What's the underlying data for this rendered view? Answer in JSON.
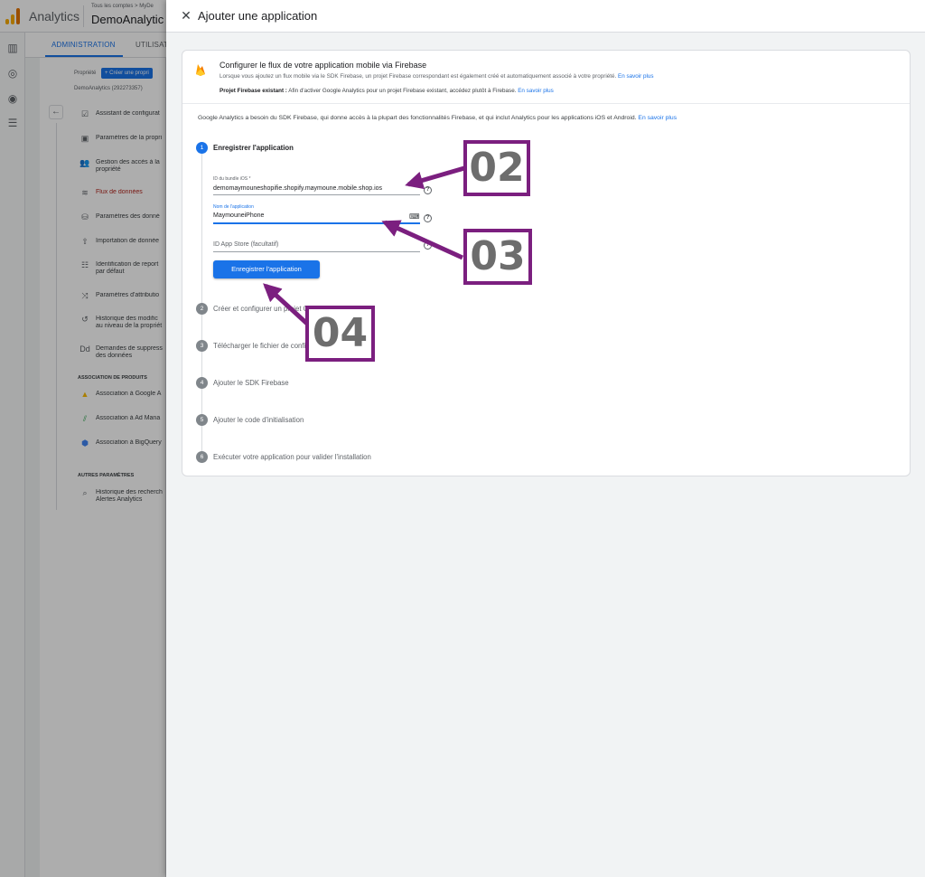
{
  "background": {
    "app_name": "Analytics",
    "breadcrumb": "Tous les comptes > MyDe",
    "account_title": "DemoAnalytic",
    "tabs": [
      "ADMINISTRATION",
      "UTILISAT"
    ],
    "property_label": "Propriété",
    "create_property": "+  Créer une propri",
    "property_id": "DemoAnalytics (292273357)",
    "nav_items": [
      "Assistant de configurat",
      "Paramètres de la propri",
      "Gestion des accès à la propriété",
      "Flux de données",
      "Paramètres des donné",
      "Importation de donnée",
      "Identification de report par défaut",
      "Paramètres d'attributio",
      "Historique des modific au niveau de la propriét",
      "Demandes de suppress des données"
    ],
    "section_products": "ASSOCIATION DE PRODUITS",
    "product_items": [
      "Association à Google A",
      "Association à Ad Mana",
      "Association à BigQuery"
    ],
    "section_other": "AUTRES PARAMÈTRES",
    "other_items": [
      "Historique des recherch Alertes Analytics"
    ]
  },
  "drawer": {
    "title": "Ajouter une application",
    "firebase": {
      "title": "Configurer le flux de votre application mobile via Firebase",
      "description": "Lorsque vous ajoutez un flux mobile via le SDK Firebase, un projet Firebase correspondant est également créé et automatiquement associé à votre propriété.",
      "existing_label": "Projet Firebase existant :",
      "existing_text": "Afin d'activer Google Analytics pour un projet Firebase existant, accédez plutôt à Firebase.",
      "learn_more": "En savoir plus"
    },
    "sdk_note": "Google Analytics a besoin du SDK Firebase, qui donne accès à la plupart des fonctionnalités Firebase, et qui inclut Analytics pour les applications iOS et Android.",
    "learn_more": "En savoir plus",
    "steps": [
      {
        "num": "1",
        "title": "Enregistrer l'application"
      },
      {
        "num": "2",
        "title": "Créer et configurer un projet Google Cloud"
      },
      {
        "num": "3",
        "title": "Télécharger le fichier de configuration"
      },
      {
        "num": "4",
        "title": "Ajouter le SDK Firebase"
      },
      {
        "num": "5",
        "title": "Ajouter le code d'initialisation"
      },
      {
        "num": "6",
        "title": "Exécuter votre application pour valider l'installation"
      }
    ],
    "fields": {
      "bundle_id": {
        "label": "ID du bundle iOS *",
        "value": "demomaymouneshopifie.shopify.maymoune.mobile.shop.ios"
      },
      "app_name": {
        "label": "Nom de l'application",
        "value": "MaymouneiPhone"
      },
      "app_store": {
        "placeholder": "ID App Store (facultatif)"
      }
    },
    "register_button": "Enregistrer l'application"
  },
  "annotations": [
    "02",
    "03",
    "04"
  ],
  "colors": {
    "accent": "#1a73e8",
    "annotation": "#7b1f7f",
    "firebase": "#f9ab00"
  }
}
